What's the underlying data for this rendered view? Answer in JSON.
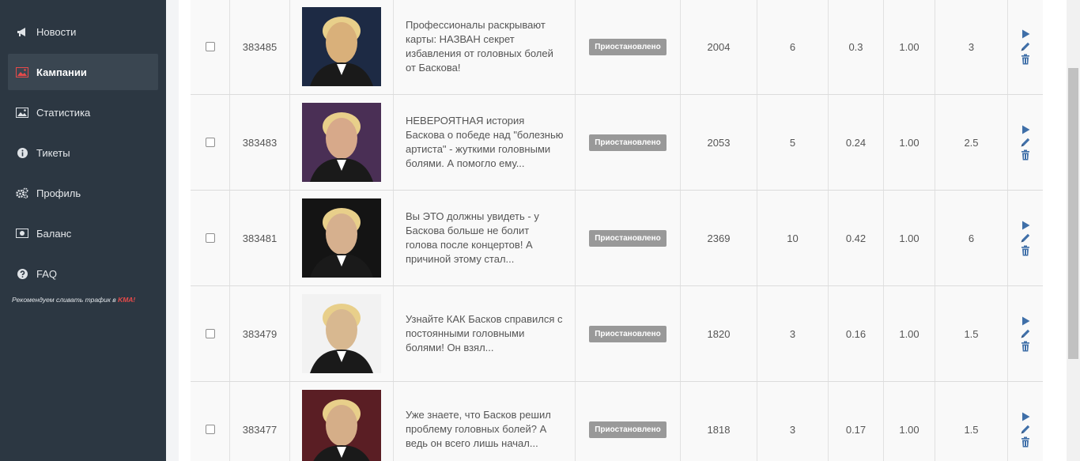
{
  "sidebar": {
    "items": [
      {
        "label": "Новости",
        "icon": "megaphone-icon",
        "active": false
      },
      {
        "label": "Кампании",
        "icon": "image-icon",
        "active": true
      },
      {
        "label": "Статистика",
        "icon": "image-icon",
        "active": false
      },
      {
        "label": "Тикеты",
        "icon": "info-icon",
        "active": false
      },
      {
        "label": "Профиль",
        "icon": "gears-icon",
        "active": false
      },
      {
        "label": "Баланс",
        "icon": "money-icon",
        "active": false
      },
      {
        "label": "FAQ",
        "icon": "question-icon",
        "active": false
      }
    ],
    "promo_text": "Рекомендуем сливать трафик в ",
    "promo_brand": "KMA!"
  },
  "campaigns": [
    {
      "id": "383485",
      "text": "Профессионалы раскрывают карты: НАЗВАН секрет избавления от головных болей от Баскова!",
      "status": "Приостановлено",
      "v1": "2004",
      "v2": "6",
      "v3": "0.3",
      "v4": "1.00",
      "v5": "3"
    },
    {
      "id": "383483",
      "text": "НЕВЕРОЯТНАЯ история Баскова о победе над \"болезнью артиста\" - жуткими головными болями. А помогло ему...",
      "status": "Приостановлено",
      "v1": "2053",
      "v2": "5",
      "v3": "0.24",
      "v4": "1.00",
      "v5": "2.5"
    },
    {
      "id": "383481",
      "text": "Вы ЭТО должны увидеть - у Баскова больше не болит голова после концертов! А причиной этому стал...",
      "status": "Приостановлено",
      "v1": "2369",
      "v2": "10",
      "v3": "0.42",
      "v4": "1.00",
      "v5": "6"
    },
    {
      "id": "383479",
      "text": "Узнайте КАК Басков справился с постоянными головными болями! Он взял...",
      "status": "Приостановлено",
      "v1": "1820",
      "v2": "3",
      "v3": "0.16",
      "v4": "1.00",
      "v5": "1.5"
    },
    {
      "id": "383477",
      "text": "Уже знаете, что Басков решил проблему головных болей? А ведь он всего лишь начал...",
      "status": "Приостановлено",
      "v1": "1818",
      "v2": "3",
      "v3": "0.17",
      "v4": "1.00",
      "v5": "1.5"
    }
  ],
  "colors": {
    "sidebar_bg": "#2c3742",
    "active_bg": "#3a4651",
    "badge_bg": "#999999",
    "icon_blue": "#3f6fa8",
    "brand_red": "#e84a4a"
  }
}
